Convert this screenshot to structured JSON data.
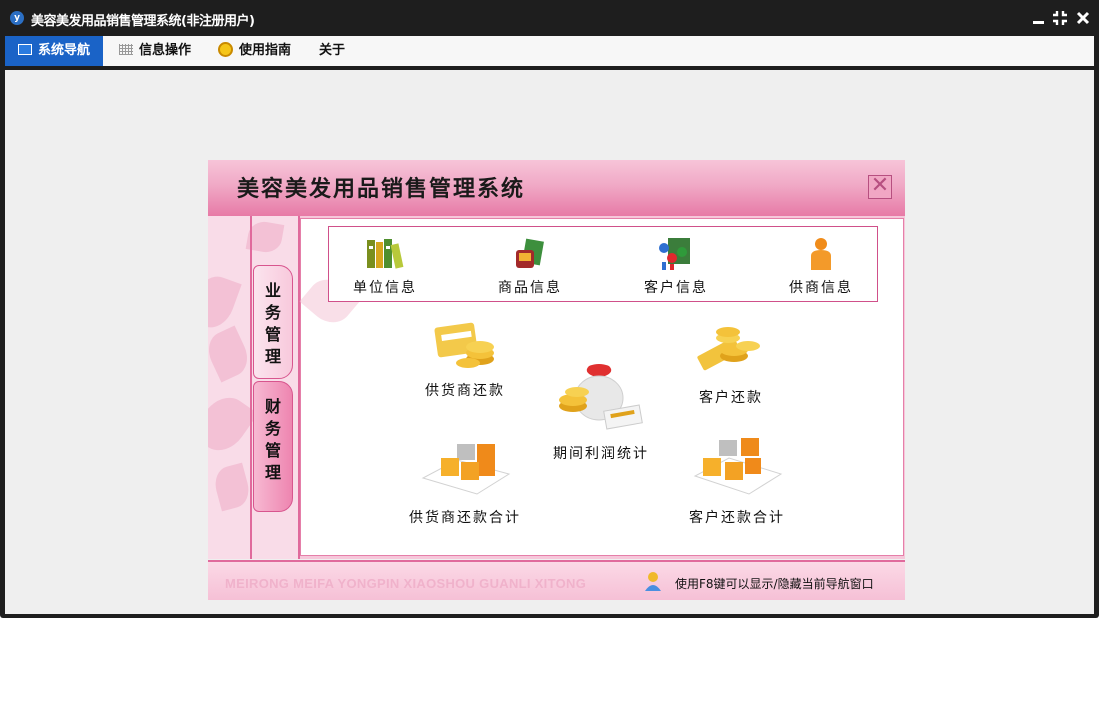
{
  "window": {
    "title": "美容美发用品销售管理系统(非注册用户)",
    "logo_letter": "y"
  },
  "menu": {
    "tabs": [
      {
        "label": "系统导航",
        "active": true
      },
      {
        "label": "信息操作"
      },
      {
        "label": "使用指南"
      },
      {
        "label": "关于"
      }
    ]
  },
  "panel": {
    "title": "美容美发用品销售管理系统",
    "close_glyph": "✕",
    "side_tabs": [
      {
        "chars": [
          "业",
          "务",
          "管",
          "理"
        ]
      },
      {
        "chars": [
          "财",
          "务",
          "管",
          "理"
        ]
      }
    ],
    "info_items": [
      {
        "label": "单位信息",
        "icon": "books-icon"
      },
      {
        "label": "商品信息",
        "icon": "product-box-icon"
      },
      {
        "label": "客户信息",
        "icon": "customers-icon"
      },
      {
        "label": "供商信息",
        "icon": "supplier-person-icon"
      }
    ],
    "finance_items": {
      "supplier_repay": "供货商还款",
      "customer_repay": "客户还款",
      "profit_stats": "期间利润统计",
      "supplier_repay_total": "供货商还款合计",
      "customer_repay_total": "客户还款合计"
    },
    "footer": {
      "pinyin": "MEIRONG MEIFA YONGPIN XIAOSHOU GUANLI XITONG",
      "tip": "使用F8键可以显示/隐藏当前导航窗口"
    }
  },
  "colors": {
    "accent_blue": "#1a63c7",
    "panel_pink": "#e77aa6",
    "border_pink": "#d0508a"
  }
}
